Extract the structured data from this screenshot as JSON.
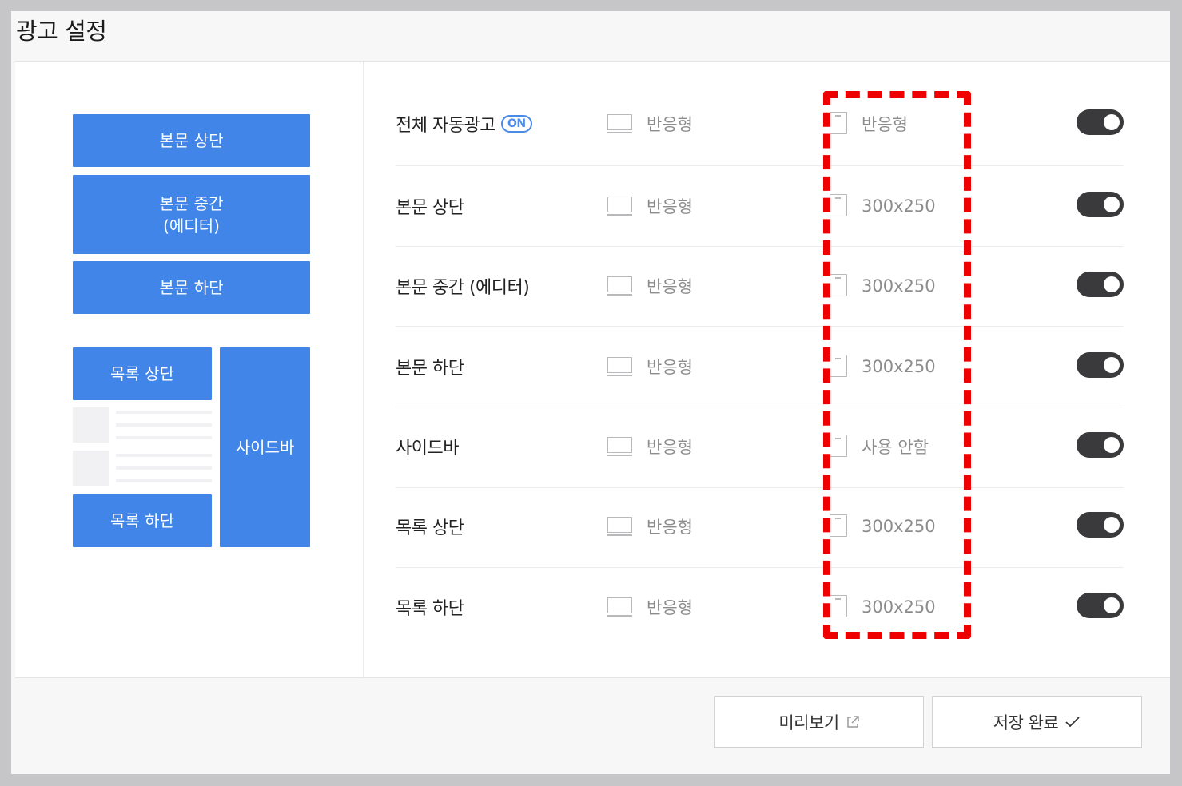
{
  "page": {
    "title": "광고 설정"
  },
  "layout_preview": {
    "top": "본문 상단",
    "middle": "본문 중간\n(에디터)",
    "bottom": "본문 하단",
    "list_top": "목록 상단",
    "list_bottom": "목록 하단",
    "sidebar": "사이드바"
  },
  "rows": [
    {
      "label": "전체 자동광고",
      "badge": "ON",
      "pc": "반응형",
      "mobile": "반응형",
      "enabled": true
    },
    {
      "label": "본문 상단",
      "pc": "반응형",
      "mobile": "300x250",
      "enabled": true
    },
    {
      "label": "본문 중간 (에디터)",
      "pc": "반응형",
      "mobile": "300x250",
      "enabled": true
    },
    {
      "label": "본문 하단",
      "pc": "반응형",
      "mobile": "300x250",
      "enabled": true
    },
    {
      "label": "사이드바",
      "pc": "반응형",
      "mobile": "사용 안함",
      "enabled": true
    },
    {
      "label": "목록 상단",
      "pc": "반응형",
      "mobile": "300x250",
      "enabled": true
    },
    {
      "label": "목록 하단",
      "pc": "반응형",
      "mobile": "300x250",
      "enabled": true
    }
  ],
  "actions": {
    "preview": "미리보기",
    "save": "저장 완료"
  },
  "colors": {
    "accent_blue": "#4285e8",
    "toggle_on": "#3a3a3c",
    "highlight_red": "#ee0000"
  }
}
